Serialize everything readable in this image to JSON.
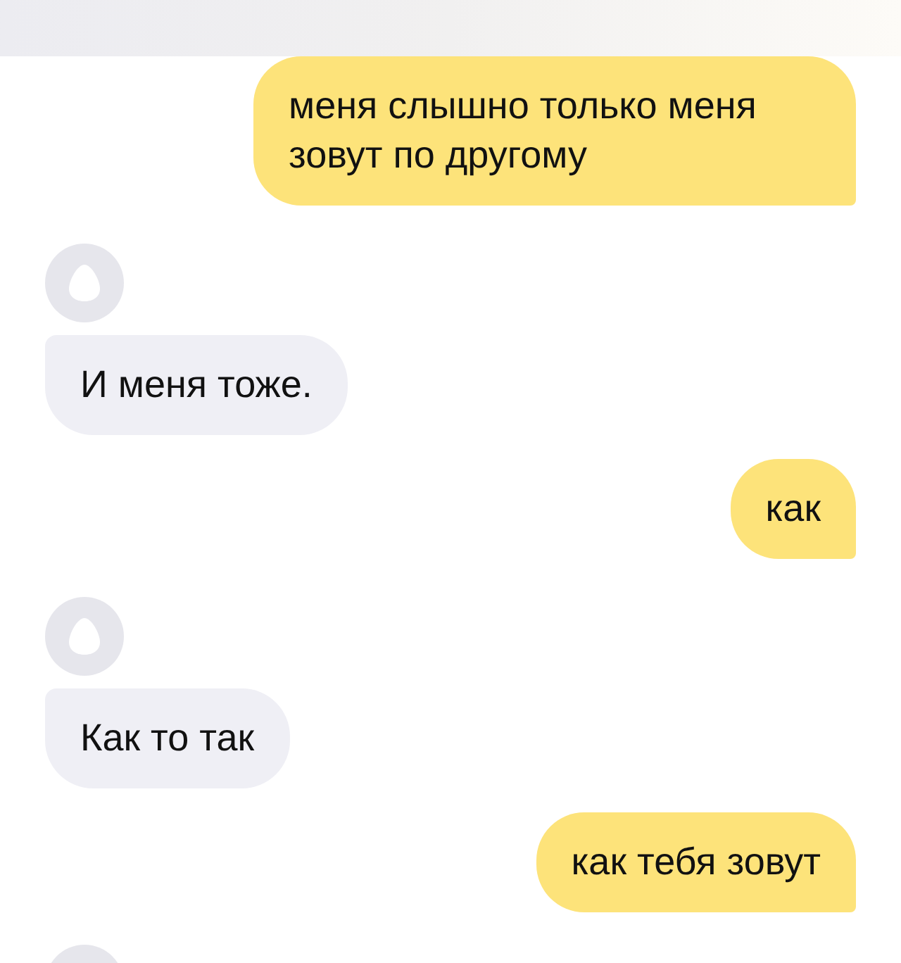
{
  "messages": [
    {
      "kind": "user",
      "text": "меня слышно только меня зовут по другому"
    },
    {
      "kind": "bot",
      "text": "И меня тоже."
    },
    {
      "kind": "user",
      "text": "как"
    },
    {
      "kind": "bot",
      "text": "Как то так"
    },
    {
      "kind": "user",
      "text": "как тебя зовут"
    },
    {
      "kind": "bot_avatar"
    }
  ]
}
